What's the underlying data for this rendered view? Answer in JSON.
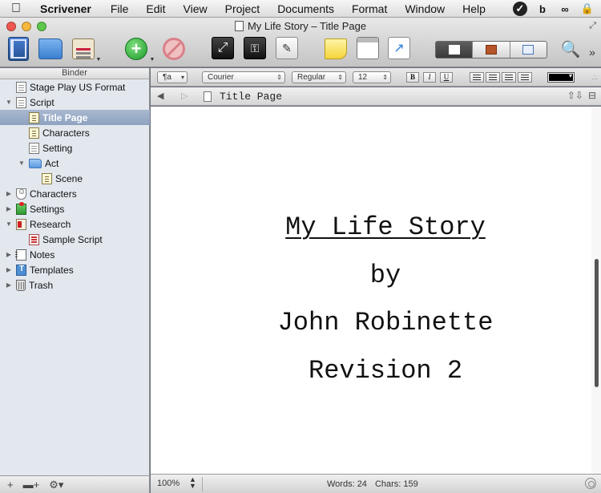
{
  "menubar": {
    "apple": "",
    "items": [
      "Scrivener",
      "File",
      "Edit",
      "View",
      "Project",
      "Documents",
      "Format",
      "Window",
      "Help"
    ],
    "status_icons": [
      "checkmark-circle-icon",
      "b-icon",
      "creative-cloud-icon",
      "lock-icon"
    ]
  },
  "window": {
    "title": "My Life Story – Title Page"
  },
  "toolbar": {
    "add_symbol": "+",
    "composition_symbol": "⤢",
    "keywords_symbol": "⚿",
    "edit_symbol": "✎",
    "export_symbol": "↗",
    "search_symbol": "🔍",
    "more_symbol": "»"
  },
  "binder": {
    "header": "Binder",
    "items": [
      {
        "label": "Stage Play US Format",
        "icon": "doc",
        "indent": 0,
        "toggle": "",
        "selected": false
      },
      {
        "label": "Script",
        "icon": "doc",
        "indent": 0,
        "toggle": "▼",
        "selected": false
      },
      {
        "label": "Title Page",
        "icon": "script",
        "indent": 1,
        "toggle": "",
        "selected": true
      },
      {
        "label": "Characters",
        "icon": "script",
        "indent": 1,
        "toggle": "",
        "selected": false
      },
      {
        "label": "Setting",
        "icon": "doc",
        "indent": 1,
        "toggle": "",
        "selected": false
      },
      {
        "label": "Act",
        "icon": "folder",
        "indent": 1,
        "toggle": "▼",
        "selected": false
      },
      {
        "label": "Scene",
        "icon": "script",
        "indent": 2,
        "toggle": "",
        "selected": false
      },
      {
        "label": "Characters",
        "icon": "masks",
        "indent": 0,
        "toggle": "▶",
        "selected": false
      },
      {
        "label": "Settings",
        "icon": "settings",
        "indent": 0,
        "toggle": "▶",
        "selected": false
      },
      {
        "label": "Research",
        "icon": "research",
        "indent": 0,
        "toggle": "▼",
        "selected": false
      },
      {
        "label": "Sample Script",
        "icon": "redscript",
        "indent": 1,
        "toggle": "",
        "selected": false
      },
      {
        "label": "Notes",
        "icon": "notes",
        "indent": 0,
        "toggle": "▶",
        "selected": false
      },
      {
        "label": "Templates",
        "icon": "templates",
        "indent": 0,
        "toggle": "▶",
        "selected": false
      },
      {
        "label": "Trash",
        "icon": "trash",
        "indent": 0,
        "toggle": "▶",
        "selected": false
      }
    ],
    "footer": {
      "add": "+",
      "add_folder": "▬+",
      "gear": "⚙▾"
    }
  },
  "formatbar": {
    "style": "¶a",
    "font": "Courier",
    "weight": "Regular",
    "size": "12",
    "bold": "B",
    "italic": "I",
    "underline": "U",
    "text_color": "#000000"
  },
  "header": {
    "back": "◀",
    "forward": "▷",
    "title": "Title Page",
    "up_down": "⇧⇩",
    "split": "⊟"
  },
  "editor": {
    "lines": [
      "My Life Story",
      "by",
      "John Robinette",
      "Revision 2"
    ]
  },
  "footer": {
    "zoom": "100%",
    "words": "Words: 24",
    "chars": "Chars: 159"
  }
}
